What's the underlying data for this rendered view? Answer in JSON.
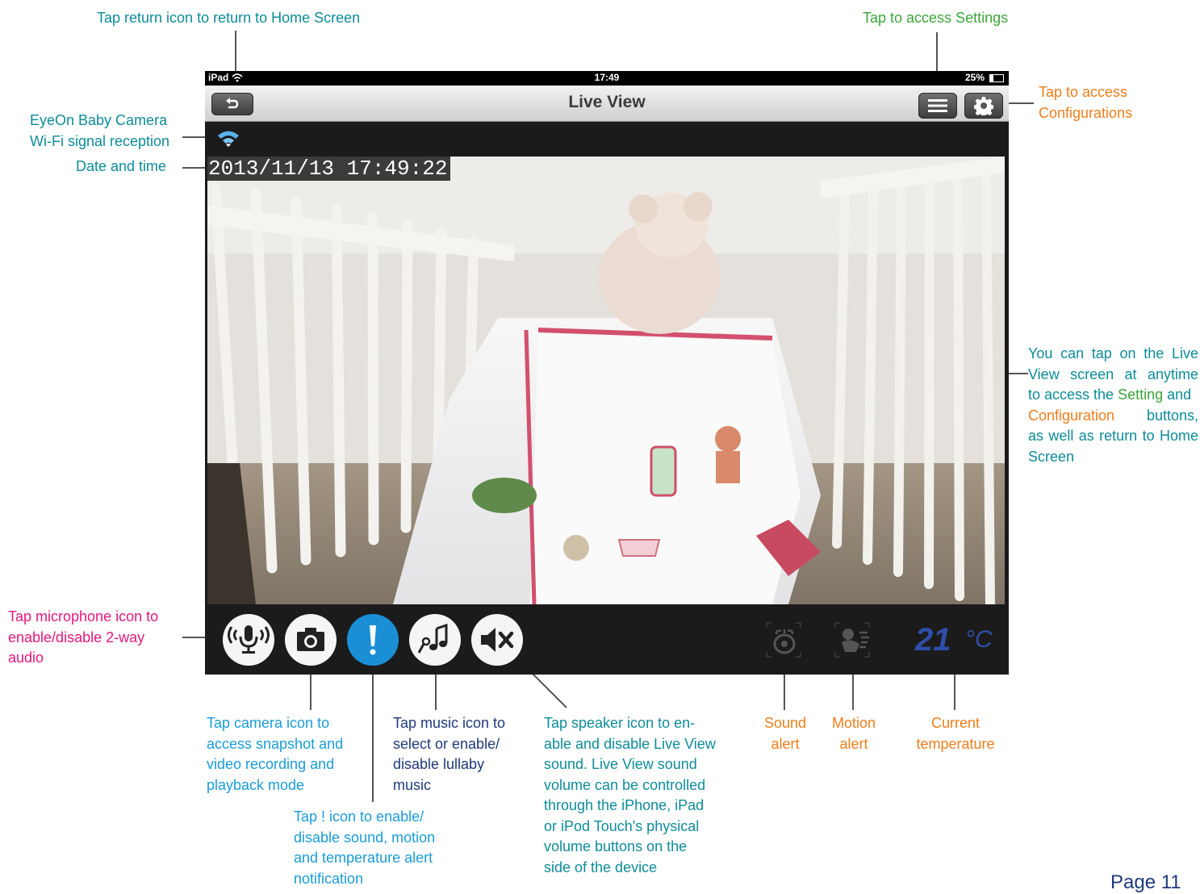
{
  "annotations": {
    "return_home": "Tap return icon to return to Home Screen",
    "settings": "Tap to access Settings",
    "configurations": "Tap to access\nConfigurations",
    "wifi": "EyeOn Baby Camera\nWi-Fi signal reception",
    "datetime": "Date and time",
    "live_view_tap_line1": "You can tap on the Live",
    "live_view_tap_line2": "View screen at anytime",
    "live_view_tap_line3_a": "to access the ",
    "live_view_tap_line3_setting": "Setting",
    "live_view_tap_line3_b": " and",
    "live_view_tap_line4_config": "Configuration",
    "live_view_tap_line4_b": "buttons,",
    "live_view_tap_line5": "as well as return to Home",
    "live_view_tap_line6": "Screen",
    "microphone": "Tap microphone icon to\nenable/disable 2-way\naudio",
    "camera": "Tap camera icon to\naccess snapshot and\nvideo recording and\nplayback mode",
    "alert": "Tap ! icon to enable/\ndisable sound, motion\nand temperature alert\nnotification",
    "music": "Tap music icon to\nselect or enable/\ndisable lullaby\nmusic",
    "speaker": "Tap speaker icon to en-\nable and disable Live View\nsound. Live View sound\nvolume can be controlled\nthrough the iPhone, iPad\nor iPod Touch's physical\nvolume buttons on the\nside of the device",
    "sound_alert": "Sound\nalert",
    "motion_alert": "Motion\nalert",
    "current_temperature": "Current\ntemperature"
  },
  "device": {
    "carrier": "iPad",
    "time": "17:49",
    "battery": "25%",
    "nav_title": "Live View",
    "timestamp": "2013/11/13 17:49:22",
    "temperature_value": "21",
    "temperature_unit": "°C"
  },
  "page_number": "Page 11",
  "colors": {
    "teal": "#0d8c9a",
    "green": "#3aa53a",
    "orange": "#ef7d1a",
    "magenta": "#e5177e",
    "sky": "#1a9cd8",
    "navy": "#1f3a7a",
    "alert_button": "#1a8fd6",
    "temperature": "#2e4fa8"
  },
  "icons": [
    "wifi-icon",
    "back-icon",
    "settings-menu-icon",
    "gear-icon",
    "microphone-icon",
    "camera-icon",
    "alert-icon",
    "music-icon",
    "speaker-mute-icon",
    "sound-alert-icon",
    "motion-alert-icon"
  ]
}
